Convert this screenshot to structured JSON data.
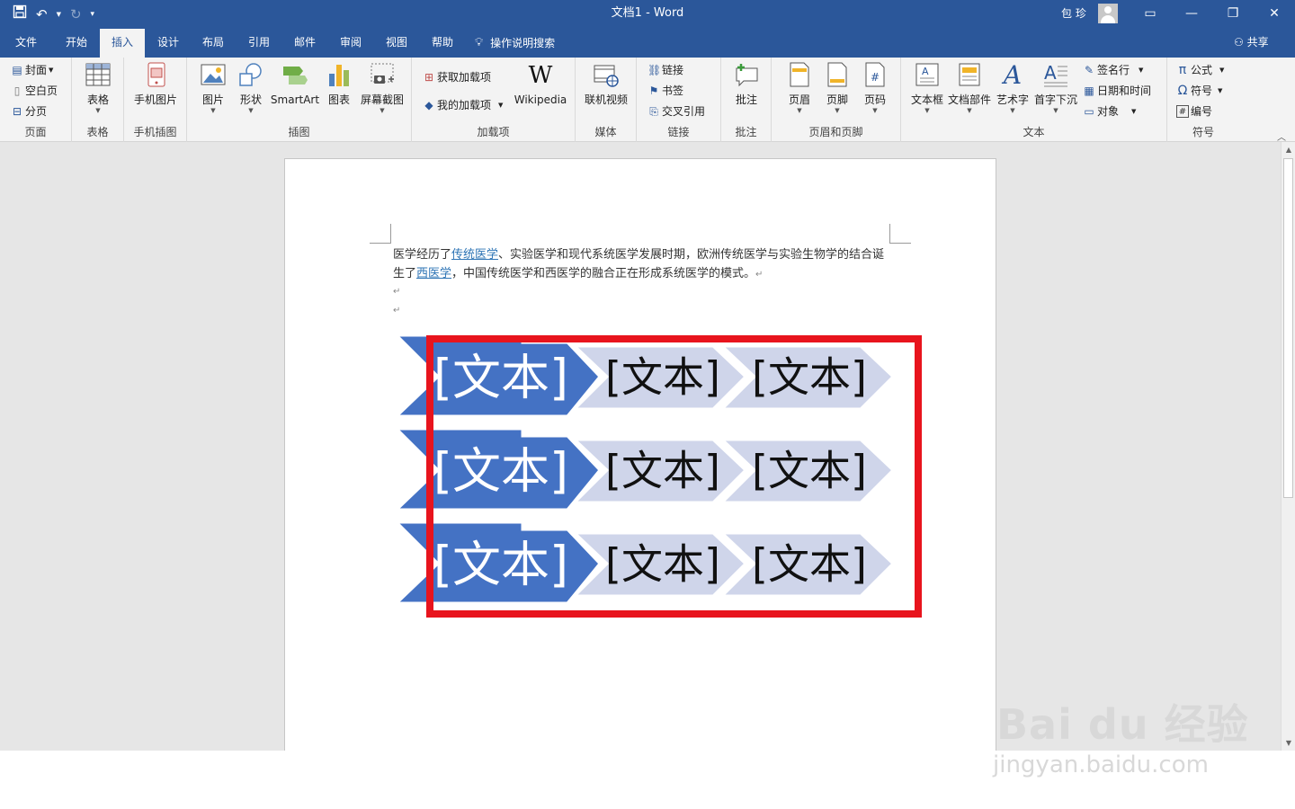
{
  "app": {
    "title": "文档1  -  Word",
    "user": "包 珍",
    "share_label": "共享"
  },
  "window_buttons": [
    "ribbon-display-options",
    "minimize",
    "restore",
    "close"
  ],
  "tabs": [
    {
      "label": "文件"
    },
    {
      "label": "开始"
    },
    {
      "label": "插入"
    },
    {
      "label": "设计"
    },
    {
      "label": "布局"
    },
    {
      "label": "引用"
    },
    {
      "label": "邮件"
    },
    {
      "label": "审阅"
    },
    {
      "label": "视图"
    },
    {
      "label": "帮助"
    }
  ],
  "active_tab": "插入",
  "tell_me": "操作说明搜索",
  "groups": {
    "pages": {
      "label": "页面",
      "cover": "封面",
      "blank": "空白页",
      "break": "分页"
    },
    "tables": {
      "label": "表格",
      "table": "表格"
    },
    "phone_images": {
      "label": "手机插图",
      "phone_picture": "手机图片"
    },
    "illustrations": {
      "label": "插图",
      "pictures": "图片",
      "shapes": "形状",
      "smartart": "SmartArt",
      "chart": "图表",
      "screenshot": "屏幕截图"
    },
    "addins": {
      "label": "加载项",
      "get": "获取加载项",
      "my": "我的加载项",
      "wikipedia": "Wikipedia"
    },
    "media": {
      "label": "媒体",
      "online_video": "联机视频"
    },
    "links": {
      "label": "链接",
      "link": "链接",
      "bookmark": "书签",
      "cross_ref": "交叉引用"
    },
    "comments": {
      "label": "批注",
      "comment": "批注"
    },
    "header_footer": {
      "label": "页眉和页脚",
      "header": "页眉",
      "footer": "页脚",
      "page_number": "页码"
    },
    "text": {
      "label": "文本",
      "textbox": "文本框",
      "quick_parts": "文档部件",
      "wordart": "艺术字",
      "dropcap": "首字下沉",
      "signature": "签名行",
      "datetime": "日期和时间",
      "object": "对象"
    },
    "symbols": {
      "label": "符号",
      "equation": "公式",
      "symbol": "符号",
      "numbering": "编号"
    }
  },
  "document": {
    "p1_before": "医学经历了",
    "link1": "传统医学",
    "p1_middle": "、实验医学和现代系统医学发展时期，欧洲传统医学与实验生物学的结合诞生了",
    "link2": "西医学",
    "p1_after": "，中国传统医学和西医学的融合正在形成系统医学的模式。",
    "para_mark": "↵"
  },
  "smartart": {
    "rows": [
      [
        "[文本]",
        "[文本]",
        "[文本]"
      ],
      [
        "[文本]",
        "[文本]",
        "[文本]"
      ],
      [
        "[文本]",
        "[文本]",
        "[文本]"
      ]
    ],
    "colors": {
      "primary": "#4472c4",
      "secondary": "#cfd5ea",
      "highlight": "#e8141d"
    }
  },
  "watermark": {
    "logo": "Bai du 经验",
    "url": "jingyan.baidu.com"
  }
}
